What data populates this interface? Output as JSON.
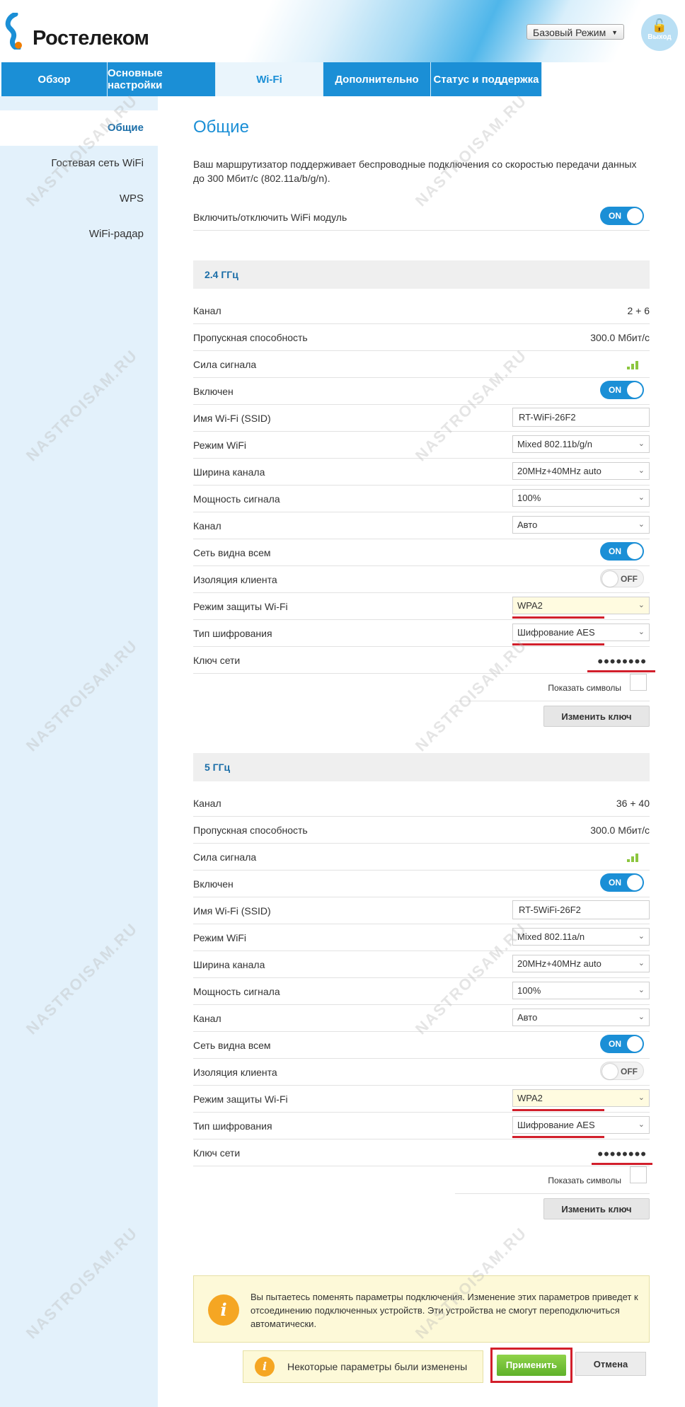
{
  "header": {
    "logo_text": "Ростелеком",
    "mode_select": "Базовый Режим",
    "logout_label": "Выход"
  },
  "nav": {
    "tabs": [
      {
        "label": "Обзор"
      },
      {
        "label": "Основные настройки"
      },
      {
        "label": "Wi-Fi",
        "active": true
      },
      {
        "label": "Дополнительно"
      },
      {
        "label": "Статус и поддержка"
      }
    ]
  },
  "sidebar": {
    "items": [
      {
        "label": "Общие",
        "active": true
      },
      {
        "label": "Гостевая сеть WiFi"
      },
      {
        "label": "WPS"
      },
      {
        "label": "WiFi-радар"
      }
    ]
  },
  "main": {
    "title": "Общие",
    "intro": "Ваш маршрутизатор поддерживает беспроводные подключения со скоростью передачи данных до 300 Мбит/с (802.11a/b/g/n).",
    "wifi_module_label": "Включить/отключить WiFi модуль",
    "wifi_module_state": "ON",
    "band24": {
      "title": "2.4 ГГц",
      "channel_label": "Канал",
      "channel_value": "2 + 6",
      "bandwidth_label": "Пропускная способность",
      "bandwidth_value": "300.0 Мбит/с",
      "signal_label": "Сила сигнала",
      "enabled_label": "Включен",
      "enabled_state": "ON",
      "ssid_label": "Имя Wi-Fi (SSID)",
      "ssid_value": "RT-WiFi-26F2",
      "mode_label": "Режим WiFi",
      "mode_value": "Mixed 802.11b/g/n",
      "width_label": "Ширина канала",
      "width_value": "20MHz+40MHz auto",
      "power_label": "Мощность сигнала",
      "power_value": "100%",
      "channel_sel_label": "Канал",
      "channel_sel_value": "Авто",
      "visible_label": "Сеть видна всем",
      "visible_state": "ON",
      "isolation_label": "Изоляция клиента",
      "isolation_state": "OFF",
      "security_label": "Режим защиты Wi-Fi",
      "security_value": "WPA2",
      "encryption_label": "Тип шифрования",
      "encryption_value": "Шифрование AES",
      "key_label": "Ключ сети",
      "key_value": "••••••••",
      "show_symbols_label": "Показать символы",
      "change_key_label": "Изменить ключ"
    },
    "band5": {
      "title": "5 ГГц",
      "channel_label": "Канал",
      "channel_value": "36 + 40",
      "bandwidth_label": "Пропускная способность",
      "bandwidth_value": "300.0 Мбит/с",
      "signal_label": "Сила сигнала",
      "enabled_label": "Включен",
      "enabled_state": "ON",
      "ssid_label": "Имя Wi-Fi (SSID)",
      "ssid_value": "RT-5WiFi-26F2",
      "mode_label": "Режим WiFi",
      "mode_value": "Mixed 802.11a/n",
      "width_label": "Ширина канала",
      "width_value": "20MHz+40MHz auto",
      "power_label": "Мощность сигнала",
      "power_value": "100%",
      "channel_sel_label": "Канал",
      "channel_sel_value": "Авто",
      "visible_label": "Сеть видна всем",
      "visible_state": "ON",
      "isolation_label": "Изоляция клиента",
      "isolation_state": "OFF",
      "security_label": "Режим защиты Wi-Fi",
      "security_value": "WPA2",
      "encryption_label": "Тип шифрования",
      "encryption_value": "Шифрование AES",
      "key_label": "Ключ сети",
      "key_value": "••••••••",
      "show_symbols_label": "Показать символы",
      "change_key_label": "Изменить ключ"
    },
    "warning_text": "Вы пытаетесь поменять параметры подключения. Изменение этих параметров приведет к отсоединению подключенных устройств. Эти устройства не смогут переподключиться автоматически.",
    "changes_notice": "Некоторые параметры были изменены",
    "apply_label": "Применить",
    "cancel_label": "Отмена"
  },
  "watermark": "NASTROISAM.RU",
  "colors": {
    "accent": "#1b8fd6",
    "highlight_red": "#d21f2b",
    "apply_green": "#6bbf2f",
    "warning_bg": "#fdf9d8"
  }
}
